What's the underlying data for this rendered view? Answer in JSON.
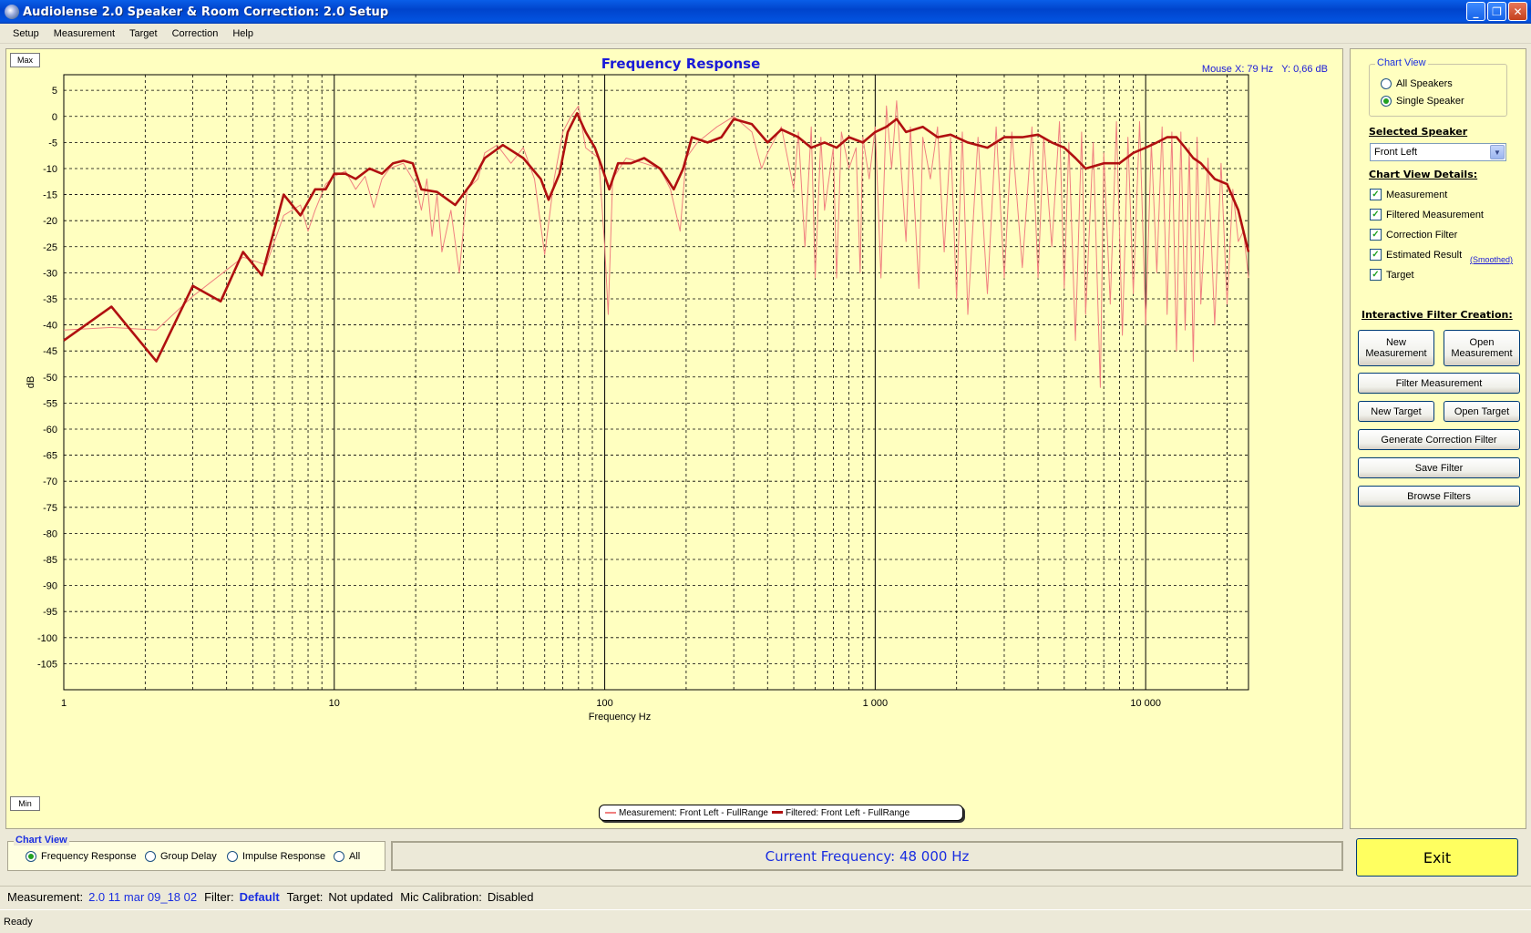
{
  "window": {
    "title": "Audiolense 2.0 Speaker & Room Correction: 2.0 Setup"
  },
  "menu": [
    "Setup",
    "Measurement",
    "Target",
    "Correction",
    "Help"
  ],
  "chart_panel": {
    "max_label": "Max",
    "min_label": "Min",
    "title": "Frequency Response",
    "mouse_x": "Mouse X: 79 Hz",
    "mouse_y": "Y: 0,66 dB",
    "legend": [
      {
        "name": "Measurement: Front Left - FullRange",
        "color": "#f08080"
      },
      {
        "name": "Filtered: Front Left - FullRange",
        "color": "#b01010"
      }
    ]
  },
  "chart_data": {
    "type": "line",
    "title": "Frequency Response",
    "xlabel": "Frequency Hz",
    "ylabel": "dB",
    "x_scale": "log",
    "xlim": [
      1,
      24000
    ],
    "ylim": [
      -110,
      8
    ],
    "grid": true,
    "legend_position": "bottom-center",
    "x_tick_labels": [
      "1",
      "10",
      "100",
      "1 000",
      "10 000"
    ],
    "y_ticks": [
      5,
      0,
      -5,
      -10,
      -15,
      -20,
      -25,
      -30,
      -35,
      -40,
      -45,
      -50,
      -55,
      -60,
      -65,
      -70,
      -75,
      -80,
      -85,
      -90,
      -95,
      -100,
      -105
    ],
    "series": [
      {
        "name": "Filtered: Front Left - FullRange",
        "color": "#b01010",
        "points": [
          [
            1,
            -43
          ],
          [
            1.5,
            -36.5
          ],
          [
            2.2,
            -47
          ],
          [
            3,
            -32.5
          ],
          [
            3.8,
            -35.5
          ],
          [
            4.6,
            -26
          ],
          [
            5.4,
            -30.5
          ],
          [
            6.5,
            -15
          ],
          [
            7.5,
            -19
          ],
          [
            8.5,
            -14
          ],
          [
            9.3,
            -14
          ],
          [
            10,
            -11
          ],
          [
            11,
            -11
          ],
          [
            12,
            -12
          ],
          [
            13.5,
            -10
          ],
          [
            15,
            -11
          ],
          [
            16.5,
            -9
          ],
          [
            18,
            -8.5
          ],
          [
            19.5,
            -9
          ],
          [
            21,
            -14
          ],
          [
            24,
            -14.5
          ],
          [
            28,
            -17
          ],
          [
            32,
            -13
          ],
          [
            36,
            -8
          ],
          [
            42,
            -5.5
          ],
          [
            50,
            -8
          ],
          [
            58,
            -12
          ],
          [
            62,
            -16
          ],
          [
            68,
            -11
          ],
          [
            73,
            -3
          ],
          [
            79,
            0.6
          ],
          [
            85,
            -3
          ],
          [
            92,
            -6
          ],
          [
            98,
            -10
          ],
          [
            104,
            -14
          ],
          [
            112,
            -9
          ],
          [
            125,
            -9
          ],
          [
            140,
            -8
          ],
          [
            160,
            -10
          ],
          [
            170,
            -12
          ],
          [
            180,
            -14
          ],
          [
            195,
            -10
          ],
          [
            210,
            -4
          ],
          [
            240,
            -5
          ],
          [
            270,
            -4
          ],
          [
            300,
            -0.5
          ],
          [
            350,
            -1.5
          ],
          [
            400,
            -5
          ],
          [
            450,
            -2.5
          ],
          [
            520,
            -4
          ],
          [
            580,
            -6
          ],
          [
            650,
            -5
          ],
          [
            720,
            -6
          ],
          [
            800,
            -4
          ],
          [
            900,
            -5
          ],
          [
            1000,
            -3
          ],
          [
            1100,
            -2
          ],
          [
            1200,
            -0.5
          ],
          [
            1300,
            -3
          ],
          [
            1500,
            -2
          ],
          [
            1700,
            -4
          ],
          [
            1900,
            -3.5
          ],
          [
            2200,
            -5
          ],
          [
            2600,
            -6
          ],
          [
            3000,
            -4
          ],
          [
            3500,
            -4
          ],
          [
            4000,
            -3.5
          ],
          [
            4500,
            -5
          ],
          [
            5000,
            -6
          ],
          [
            5500,
            -8
          ],
          [
            6000,
            -10
          ],
          [
            7000,
            -9
          ],
          [
            8000,
            -9
          ],
          [
            9000,
            -7
          ],
          [
            10000,
            -6
          ],
          [
            11000,
            -5
          ],
          [
            12000,
            -4
          ],
          [
            13000,
            -4
          ],
          [
            14000,
            -6
          ],
          [
            15000,
            -8
          ],
          [
            16000,
            -9
          ],
          [
            18000,
            -12
          ],
          [
            20000,
            -13
          ],
          [
            22000,
            -18
          ],
          [
            24000,
            -26
          ]
        ]
      },
      {
        "name": "Measurement: Front Left - FullRange",
        "color": "#f08080",
        "points": [
          [
            1,
            -41
          ],
          [
            1.5,
            -40.5
          ],
          [
            2.2,
            -41
          ],
          [
            3,
            -34.5
          ],
          [
            4.6,
            -27
          ],
          [
            5.6,
            -28.5
          ],
          [
            6.5,
            -19
          ],
          [
            7.5,
            -17
          ],
          [
            8,
            -22
          ],
          [
            8.5,
            -18
          ],
          [
            9.3,
            -13
          ],
          [
            10,
            -11.5
          ],
          [
            11,
            -10.5
          ],
          [
            12,
            -14
          ],
          [
            13,
            -11.5
          ],
          [
            14,
            -17.5
          ],
          [
            15,
            -12
          ],
          [
            16,
            -10
          ],
          [
            18,
            -9
          ],
          [
            20,
            -13
          ],
          [
            21,
            -18
          ],
          [
            22,
            -12
          ],
          [
            23,
            -23
          ],
          [
            24,
            -15
          ],
          [
            25,
            -26
          ],
          [
            27,
            -18
          ],
          [
            29,
            -30
          ],
          [
            31,
            -14
          ],
          [
            34,
            -12
          ],
          [
            36,
            -7
          ],
          [
            40,
            -5.5
          ],
          [
            45,
            -9
          ],
          [
            50,
            -6
          ],
          [
            55,
            -12
          ],
          [
            60,
            -26.5
          ],
          [
            65,
            -12
          ],
          [
            70,
            -3
          ],
          [
            75,
            0
          ],
          [
            80,
            2
          ],
          [
            85,
            -6
          ],
          [
            95,
            -8
          ],
          [
            100,
            -25
          ],
          [
            103,
            -38
          ],
          [
            107,
            -12
          ],
          [
            120,
            -8
          ],
          [
            140,
            -9
          ],
          [
            160,
            -10
          ],
          [
            175,
            -14
          ],
          [
            190,
            -22
          ],
          [
            200,
            -8
          ],
          [
            220,
            -5
          ],
          [
            260,
            -2
          ],
          [
            300,
            0
          ],
          [
            350,
            -3
          ],
          [
            380,
            -10
          ],
          [
            400,
            -7
          ],
          [
            450,
            -2
          ],
          [
            500,
            -14
          ],
          [
            520,
            -3
          ],
          [
            550,
            -25
          ],
          [
            580,
            -2
          ],
          [
            600,
            -31
          ],
          [
            630,
            -4
          ],
          [
            650,
            -18
          ],
          [
            700,
            -6
          ],
          [
            720,
            -31
          ],
          [
            750,
            -3
          ],
          [
            800,
            -10
          ],
          [
            850,
            -6
          ],
          [
            880,
            -30
          ],
          [
            900,
            -4
          ],
          [
            950,
            -12
          ],
          [
            1000,
            -2
          ],
          [
            1050,
            -31
          ],
          [
            1100,
            2
          ],
          [
            1150,
            -10
          ],
          [
            1200,
            3
          ],
          [
            1300,
            -24
          ],
          [
            1350,
            -2
          ],
          [
            1450,
            -33
          ],
          [
            1500,
            -4
          ],
          [
            1600,
            -12
          ],
          [
            1700,
            -2
          ],
          [
            1800,
            -26
          ],
          [
            1900,
            -4
          ],
          [
            2000,
            -35
          ],
          [
            2100,
            -3
          ],
          [
            2200,
            -38
          ],
          [
            2400,
            -4
          ],
          [
            2600,
            -34
          ],
          [
            2800,
            -2
          ],
          [
            3000,
            -31
          ],
          [
            3200,
            -3
          ],
          [
            3500,
            -29
          ],
          [
            3800,
            -2
          ],
          [
            4000,
            -31
          ],
          [
            4200,
            -4
          ],
          [
            4500,
            -25
          ],
          [
            4800,
            -1
          ],
          [
            5000,
            -33
          ],
          [
            5200,
            -5
          ],
          [
            5500,
            -43
          ],
          [
            5800,
            -3
          ],
          [
            6000,
            -38
          ],
          [
            6400,
            -5
          ],
          [
            6800,
            -52
          ],
          [
            7000,
            -7
          ],
          [
            7400,
            -36
          ],
          [
            7800,
            -1
          ],
          [
            8200,
            -42
          ],
          [
            8600,
            -4
          ],
          [
            9000,
            -34
          ],
          [
            9500,
            -1
          ],
          [
            10000,
            -40
          ],
          [
            10500,
            -5
          ],
          [
            11000,
            -30
          ],
          [
            11500,
            -2
          ],
          [
            12000,
            -38
          ],
          [
            12500,
            -3
          ],
          [
            13000,
            -45
          ],
          [
            13500,
            -3
          ],
          [
            14000,
            -41
          ],
          [
            14500,
            -6
          ],
          [
            15000,
            -47
          ],
          [
            15500,
            -4
          ],
          [
            16000,
            -36
          ],
          [
            17000,
            -8
          ],
          [
            18000,
            -40
          ],
          [
            19000,
            -9
          ],
          [
            20000,
            -36
          ],
          [
            21000,
            -14
          ],
          [
            22000,
            -24
          ],
          [
            23000,
            -22
          ],
          [
            24000,
            -31
          ]
        ]
      }
    ]
  },
  "side_panel": {
    "chart_view_title": "Chart View",
    "chart_view_options": [
      {
        "label": "All Speakers",
        "selected": false
      },
      {
        "label": "Single Speaker",
        "selected": true
      }
    ],
    "selected_speaker_title": "Selected Speaker",
    "selected_speaker_value": "Front Left",
    "details_title": "Chart View Details:",
    "details": [
      {
        "label": "Measurement",
        "checked": true
      },
      {
        "label": "Filtered Measurement",
        "checked": true
      },
      {
        "label": "Correction Filter",
        "checked": true
      },
      {
        "label": "Estimated Result",
        "checked": true
      },
      {
        "label": "Target",
        "checked": true
      }
    ],
    "smoothed_link": "(Smoothed)",
    "interactive_title": "Interactive Filter Creation:",
    "buttons": {
      "new_measurement": "New Measurement",
      "open_measurement": "Open Measurement",
      "filter_measurement": "Filter Measurement",
      "new_target": "New Target",
      "open_target": "Open Target",
      "generate_correction": "Generate Correction Filter",
      "save_filter": "Save Filter",
      "browse_filters": "Browse Filters"
    }
  },
  "bottom": {
    "chart_view_title": "Chart View",
    "views": [
      {
        "label": "Frequency Response",
        "selected": true
      },
      {
        "label": "Group Delay",
        "selected": false
      },
      {
        "label": "Impulse Response",
        "selected": false
      },
      {
        "label": "All",
        "selected": false
      }
    ],
    "current_frequency": "Current Frequency: 48 000 Hz",
    "exit": "Exit"
  },
  "info": {
    "measurement_label": "Measurement:",
    "measurement_value": "2.0 11 mar 09_18 02",
    "filter_label": "Filter:",
    "filter_value": "Default",
    "target_label": "Target:",
    "target_value": "Not updated",
    "mic_label": "Mic Calibration:",
    "mic_value": "Disabled"
  },
  "status": "Ready"
}
